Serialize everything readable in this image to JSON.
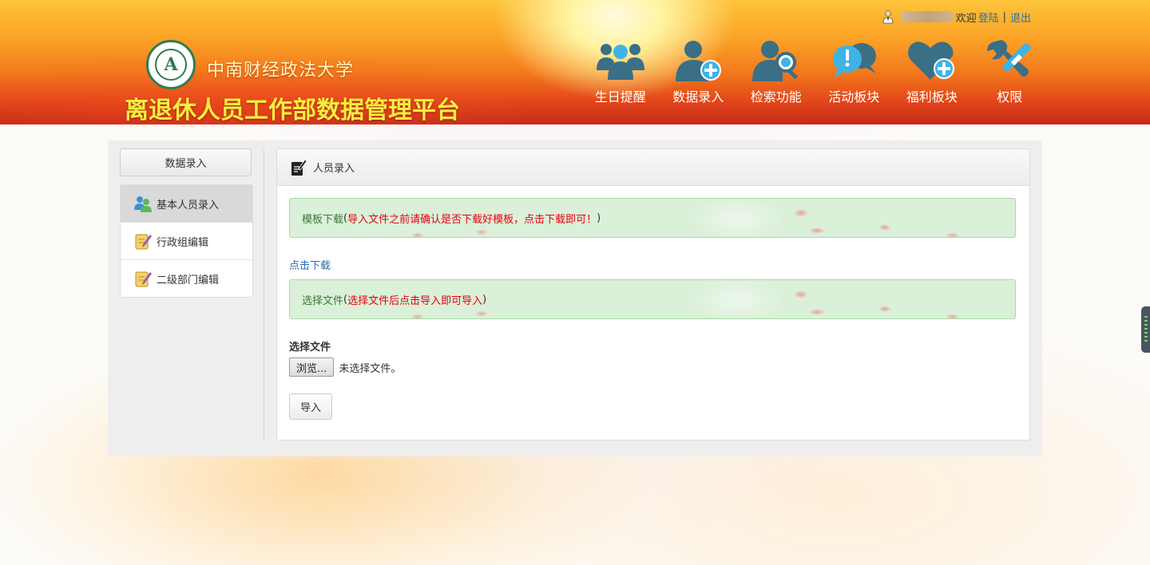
{
  "header": {
    "university_name": "中南财经政法大学",
    "platform_title": "离退休人员工作部数据管理平台",
    "logo_letter": "A",
    "user": {
      "welcome": "欢迎",
      "login_link": "登陆",
      "separator": "|",
      "logout_link": "退出"
    },
    "nav": [
      {
        "label": "生日提醒",
        "icon": "group-users-icon"
      },
      {
        "label": "数据录入",
        "icon": "add-user-icon"
      },
      {
        "label": "检索功能",
        "icon": "user-search-icon"
      },
      {
        "label": "活动板块",
        "icon": "chat-alert-icon"
      },
      {
        "label": "福利板块",
        "icon": "heart-plus-icon"
      },
      {
        "label": "权限",
        "icon": "tools-icon"
      }
    ],
    "colors": {
      "nav_icon": "#3a6f86",
      "nav_icon_accent": "#3fb3e6",
      "platform_title": "#f6ee3e"
    }
  },
  "sidebar": {
    "heading": "数据录入",
    "items": [
      {
        "label": "基本人员录入",
        "icon": "users-icon",
        "active": true
      },
      {
        "label": "行政组编辑",
        "icon": "edit-note-icon",
        "active": false
      },
      {
        "label": "二级部门编辑",
        "icon": "edit-note-icon",
        "active": false
      }
    ]
  },
  "panel": {
    "title": "人员录入",
    "alert_template": {
      "label": "模板下载",
      "open": " (",
      "note": "导入文件之前请确认是否下载好模板，点击下载即可！",
      "close": ")"
    },
    "download_link": "点击下载",
    "alert_file": {
      "label": "选择文件",
      "open": " (",
      "note": "选择文件后点击导入即可导入",
      "close": ")"
    },
    "file_label": "选择文件",
    "browse_button": "浏览...",
    "no_file_text": "未选择文件。",
    "import_button": "导入"
  }
}
